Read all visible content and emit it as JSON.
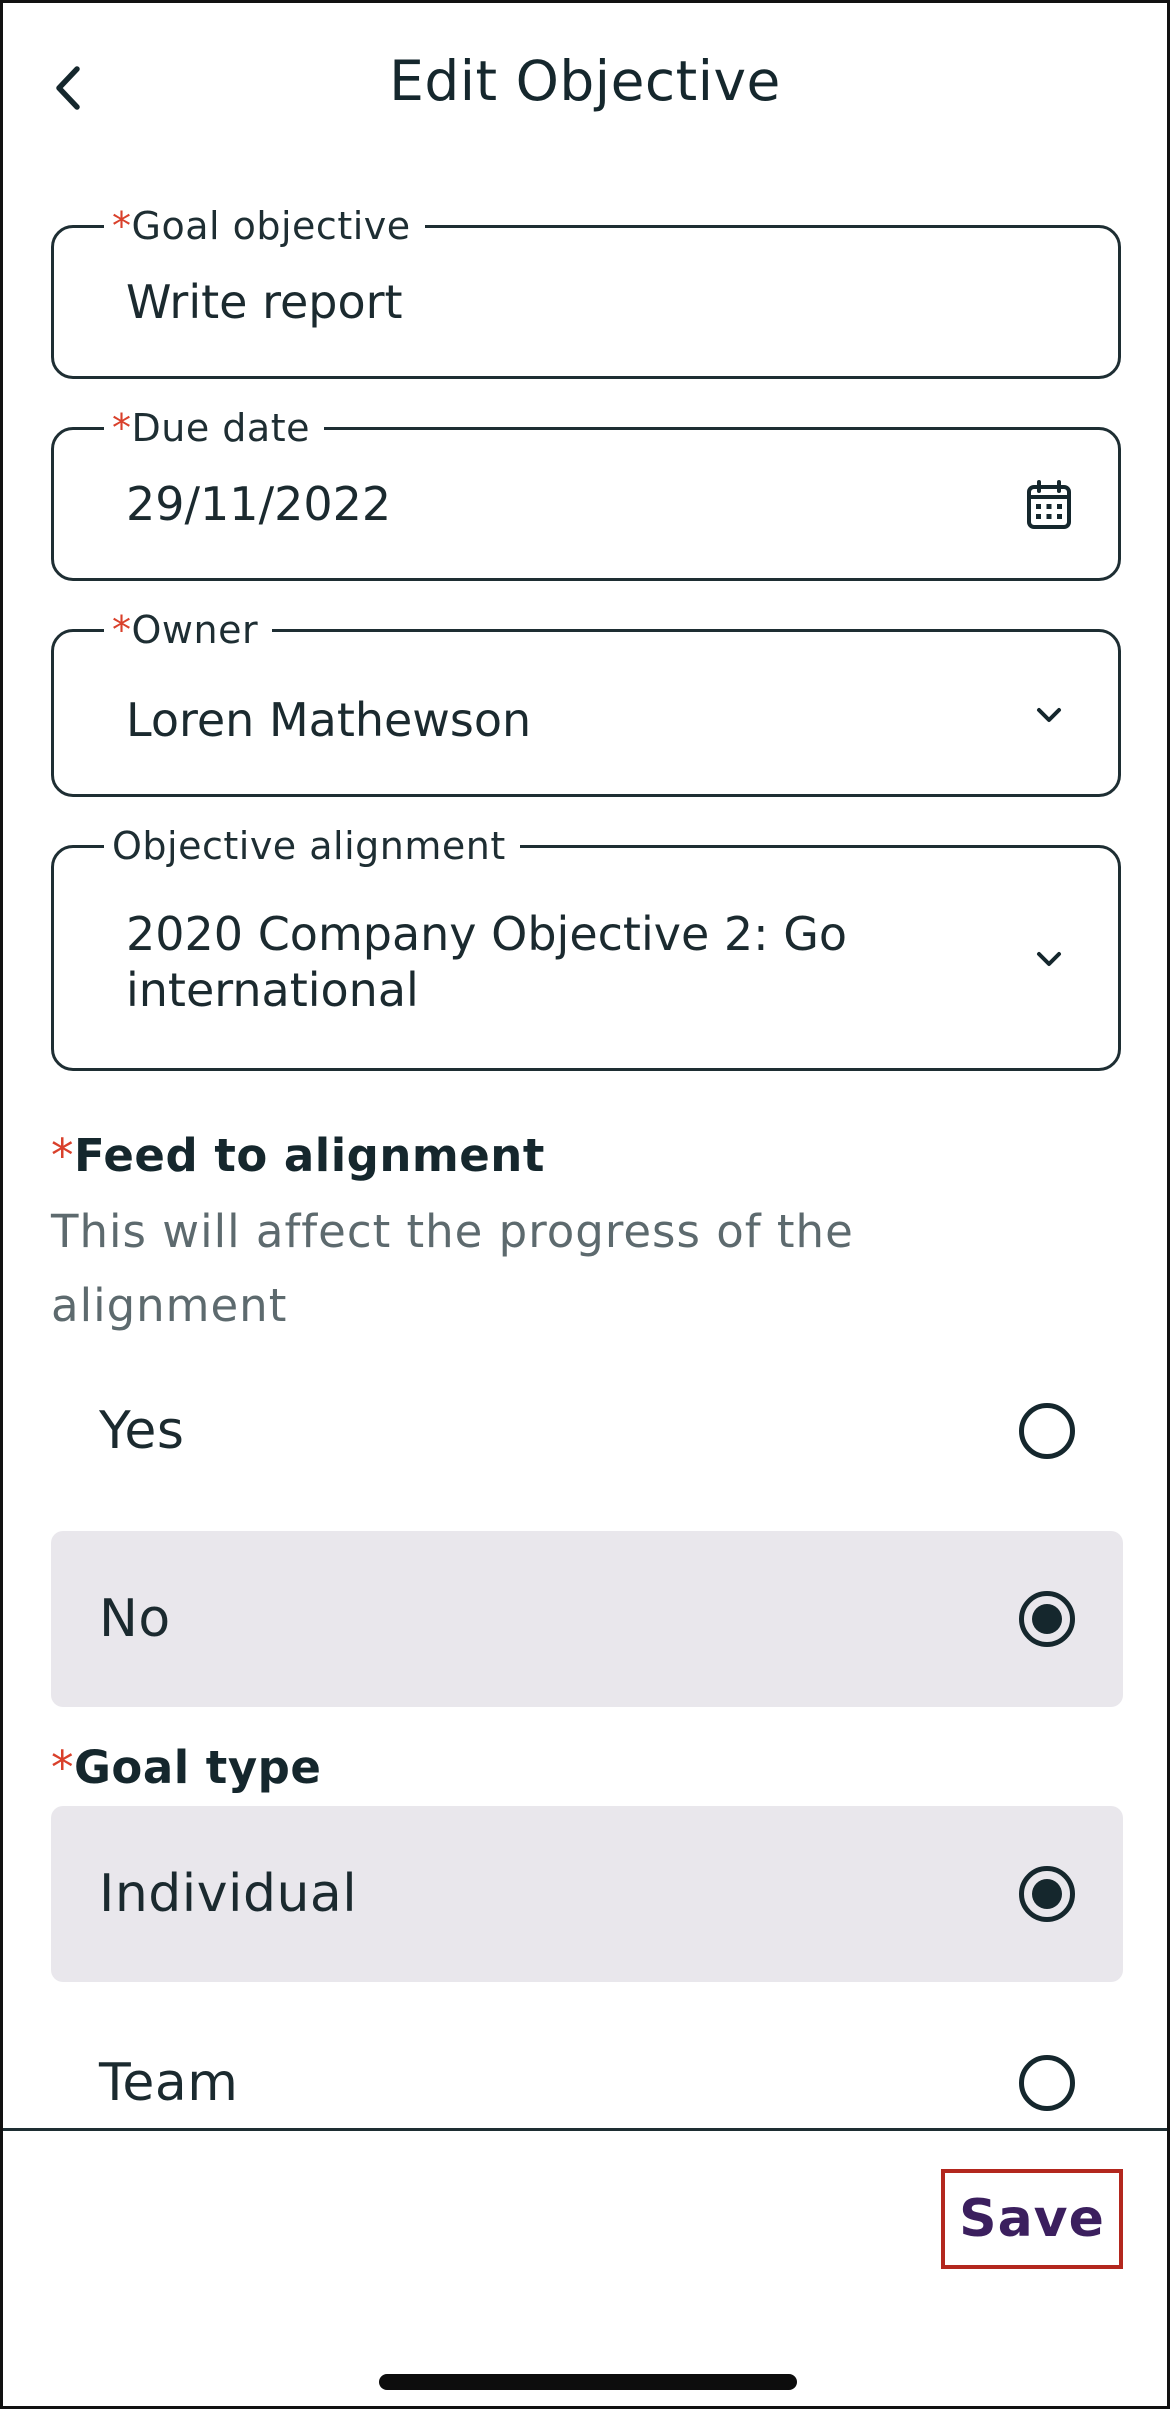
{
  "header": {
    "title": "Edit Objective",
    "back_icon": "chevron-left-icon"
  },
  "form": {
    "goal_objective": {
      "required_mark": "*",
      "label": "Goal objective",
      "value": "Write report"
    },
    "due_date": {
      "required_mark": "*",
      "label": "Due date",
      "value": "29/11/2022",
      "icon": "calendar-icon"
    },
    "owner": {
      "required_mark": "*",
      "label": "Owner",
      "value": "Loren Mathewson",
      "icon": "chevron-down-icon"
    },
    "objective_alignment": {
      "label": "Objective alignment",
      "value": "2020 Company Objective 2: Go international",
      "icon": "chevron-down-icon"
    },
    "feed_to_alignment": {
      "required_mark": "*",
      "label": "Feed to alignment",
      "help": "This will affect the progress of the alignment",
      "options": [
        {
          "label": "Yes",
          "selected": false
        },
        {
          "label": "No",
          "selected": true
        }
      ]
    },
    "goal_type": {
      "required_mark": "*",
      "label": "Goal type",
      "options": [
        {
          "label": "Individual",
          "selected": true
        },
        {
          "label": "Team",
          "selected": false
        }
      ]
    }
  },
  "footer": {
    "save_label": "Save"
  },
  "colors": {
    "required": "#d9402b",
    "save_text": "#3b1f5e",
    "save_highlight": "#b3271e",
    "selected_bg": "#e9e7ec"
  }
}
